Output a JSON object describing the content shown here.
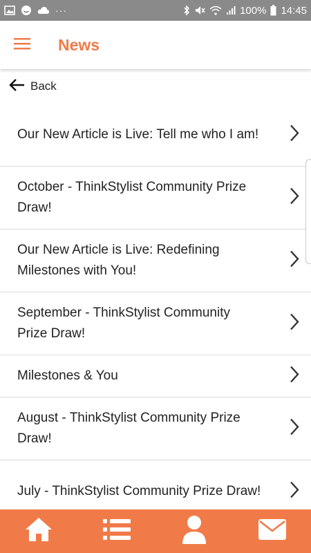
{
  "status_bar": {
    "battery_text": "100%",
    "time": "14:45",
    "left_icons": [
      "image-icon",
      "smiley-icon",
      "cloud-icon",
      "more-dots-icon"
    ],
    "right_icons": [
      "bluetooth-icon",
      "mute-icon",
      "wifi-icon",
      "signal-icon",
      "battery-icon"
    ]
  },
  "app_bar": {
    "title": "News",
    "menu_icon": "hamburger-menu-icon",
    "accent_color": "#f07b48"
  },
  "back": {
    "label": "Back",
    "icon": "arrow-left-icon"
  },
  "news": {
    "items": [
      {
        "title": "Our New Article is Live: Tell me who I am!"
      },
      {
        "title": "October - ThinkStylist Community Prize Draw!"
      },
      {
        "title": "Our New Article is Live: Redefining Milestones with You!"
      },
      {
        "title": "September - ThinkStylist Community Prize Draw!"
      },
      {
        "title": "Milestones & You"
      },
      {
        "title": "August - ThinkStylist Community Prize Draw!"
      },
      {
        "title": "July - ThinkStylist Community Prize Draw!"
      }
    ]
  },
  "bottom_nav": {
    "background": "#f07b48",
    "items": [
      "home-icon",
      "list-icon",
      "user-icon",
      "mail-icon"
    ]
  }
}
